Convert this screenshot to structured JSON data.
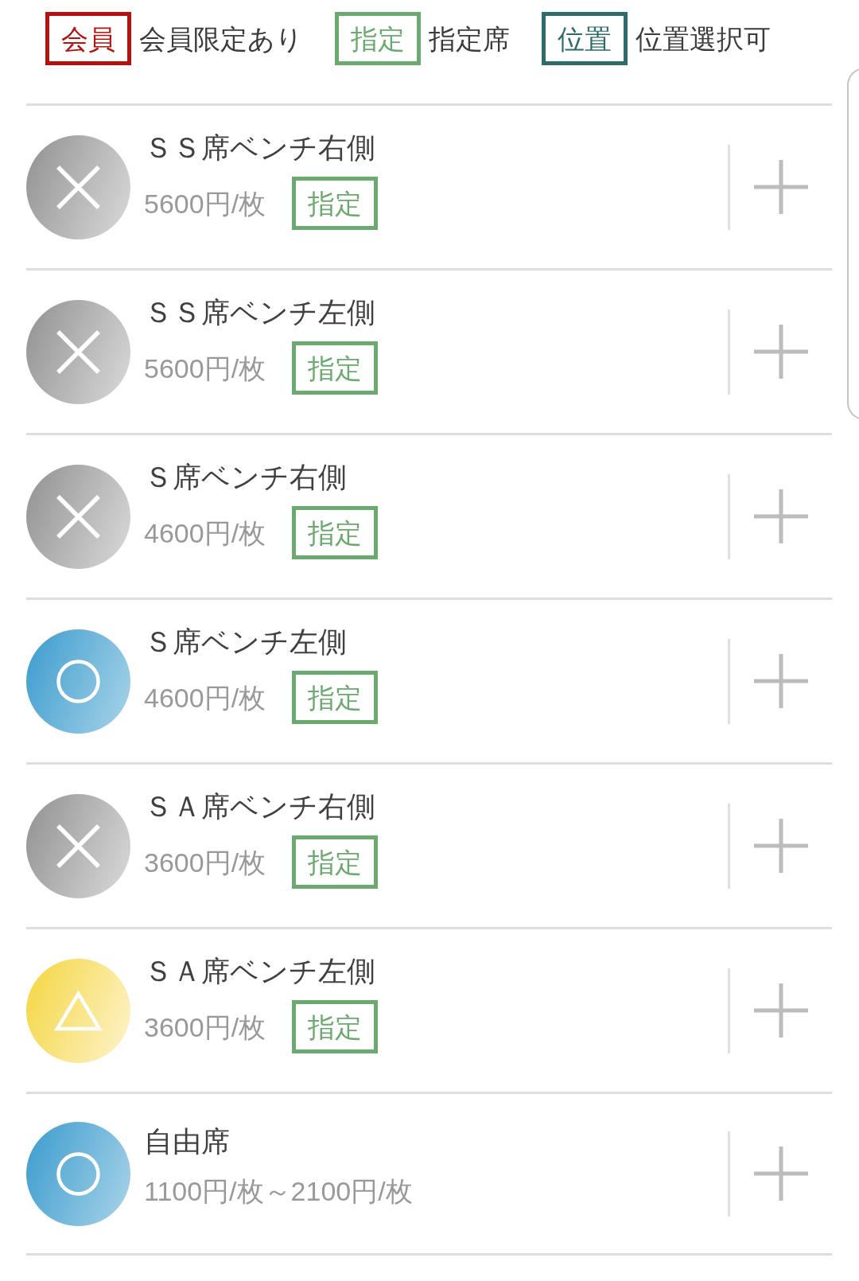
{
  "legend": [
    {
      "badge": "会員",
      "label": "会員限定あり",
      "color": "#b3120f"
    },
    {
      "badge": "指定",
      "label": "指定席",
      "color": "#6aaa6e"
    },
    {
      "badge": "位置",
      "label": "位置選択可",
      "color": "#2e6b6b"
    }
  ],
  "seats": [
    {
      "name": "ＳＳ席ベンチ右側",
      "kind": "sold_out",
      "price": "5600円/枚",
      "tags": [
        {
          "label": "指定",
          "color": "#6aaa6e"
        }
      ]
    },
    {
      "name": "ＳＳ席ベンチ左側",
      "kind": "sold_out",
      "price": "5600円/枚",
      "tags": [
        {
          "label": "指定",
          "color": "#6aaa6e"
        }
      ]
    },
    {
      "name": "Ｓ席ベンチ右側",
      "kind": "sold_out",
      "price": "4600円/枚",
      "tags": [
        {
          "label": "指定",
          "color": "#6aaa6e"
        }
      ]
    },
    {
      "name": "Ｓ席ベンチ左側",
      "kind": "available",
      "price": "4600円/枚",
      "tags": [
        {
          "label": "指定",
          "color": "#6aaa6e"
        }
      ]
    },
    {
      "name": "ＳＡ席ベンチ右側",
      "kind": "sold_out",
      "price": "3600円/枚",
      "tags": [
        {
          "label": "指定",
          "color": "#6aaa6e"
        }
      ]
    },
    {
      "name": "ＳＡ席ベンチ左側",
      "kind": "few_left",
      "price": "3600円/枚",
      "tags": [
        {
          "label": "指定",
          "color": "#6aaa6e"
        }
      ]
    },
    {
      "name": "自由席",
      "kind": "available",
      "price": "1100円/枚～2100円/枚"
    }
  ]
}
